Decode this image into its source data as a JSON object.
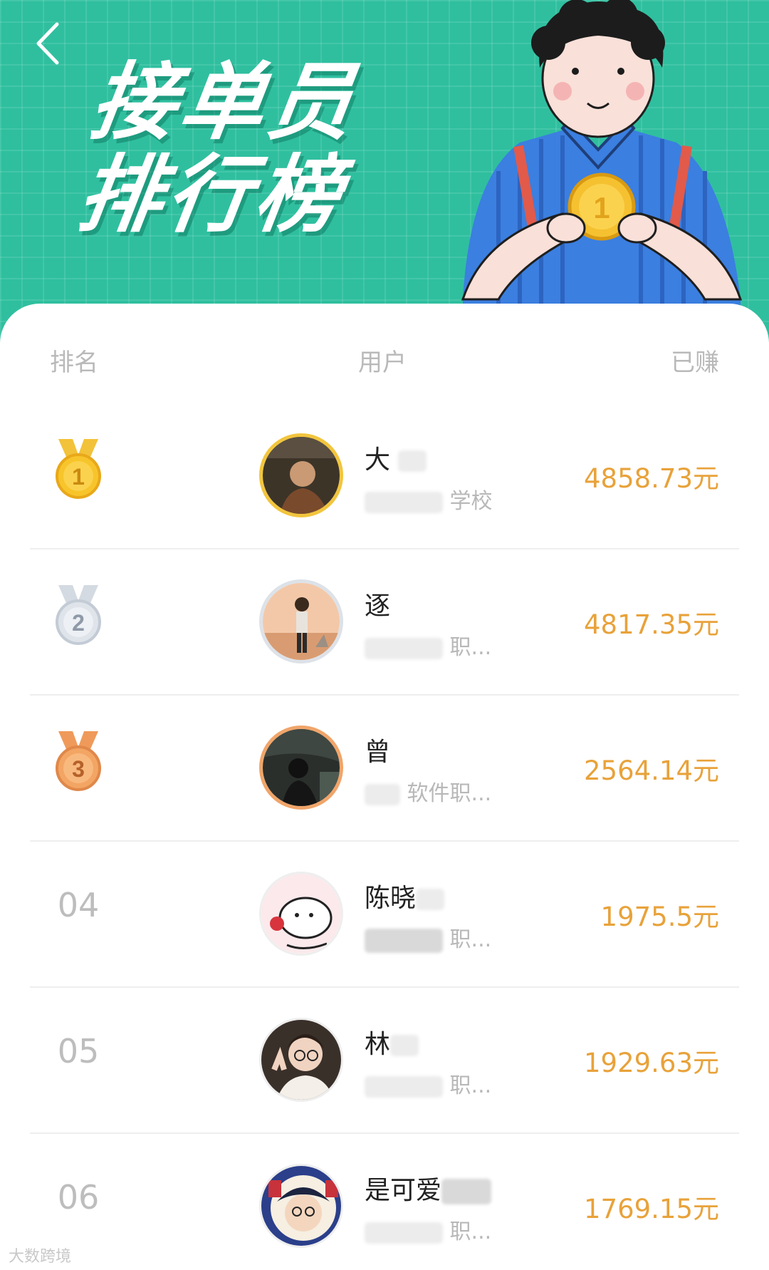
{
  "header": {
    "back_icon": "chevron-left-icon",
    "title_line1": "接单员",
    "title_line2": "排行榜"
  },
  "table": {
    "col_rank": "排名",
    "col_user": "用户",
    "col_earned": "已赚"
  },
  "rows": [
    {
      "rank": "1",
      "medal": "gold-medal-icon",
      "name": "大",
      "school": "学校",
      "amount": "4858.73元"
    },
    {
      "rank": "2",
      "medal": "silver-medal-icon",
      "name": "逐",
      "school": "职...",
      "amount": "4817.35元"
    },
    {
      "rank": "3",
      "medal": "bronze-medal-icon",
      "name": "曾",
      "school": "软件职...",
      "amount": "2564.14元"
    },
    {
      "rank": "04",
      "name": "陈晓",
      "school": "职...",
      "amount": "1975.5元"
    },
    {
      "rank": "05",
      "name": "林",
      "school": "职...",
      "amount": "1929.63元"
    },
    {
      "rank": "06",
      "name": "是可爱",
      "school": "职...",
      "amount": "1769.15元"
    }
  ],
  "watermark": "大数跨境",
  "colors": {
    "hero_bg": "#2fbf9f",
    "amount": "#e8a23a",
    "gold": "#f2c53d",
    "silver": "#dde2e8",
    "bronze": "#f0a56a"
  }
}
